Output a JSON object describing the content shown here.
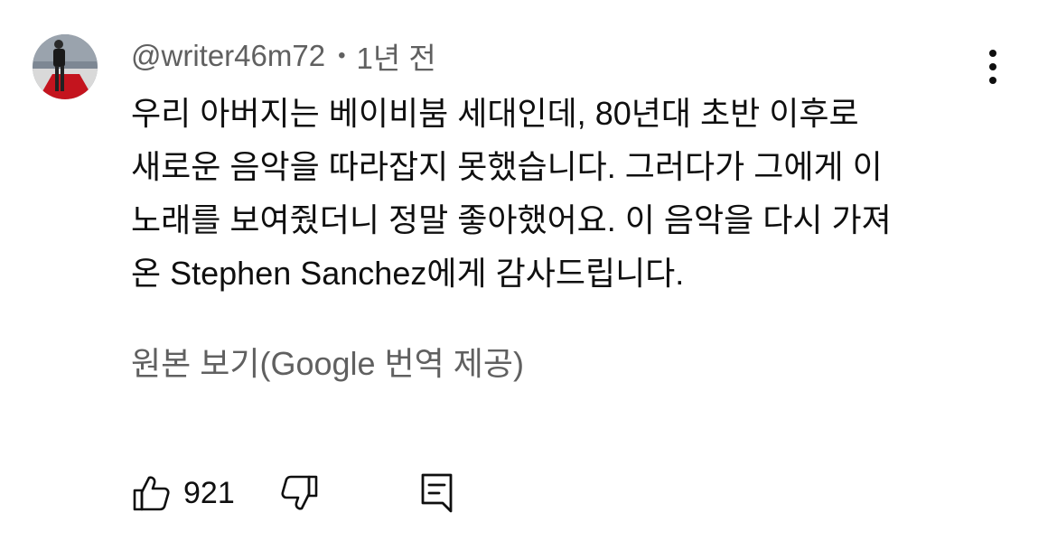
{
  "comment": {
    "author": "@writer46m72",
    "separator": "•",
    "time": "1년 전",
    "text_lines": [
      "우리 아버지는 베이비붐 세대인데, 80년대 초반 이후로",
      "새로운 음악을 따라잡지 못했습니다. 그러다가 그에게 이",
      "노래를 보여줬더니 정말 좋아했어요. 이 음악을 다시 가져",
      "온 Stephen Sanchez에게 감사드립니다."
    ],
    "translate_link": "원본 보기(Google 번역 제공)",
    "like_count": "921"
  },
  "icons": {
    "avatar": "avatar-photo",
    "more": "more-vertical-icon",
    "like": "thumbs-up-icon",
    "dislike": "thumbs-down-icon",
    "reply": "comment-reply-icon"
  },
  "colors": {
    "primary_text": "#0f0f0f",
    "secondary_text": "#606060",
    "background": "#ffffff"
  }
}
